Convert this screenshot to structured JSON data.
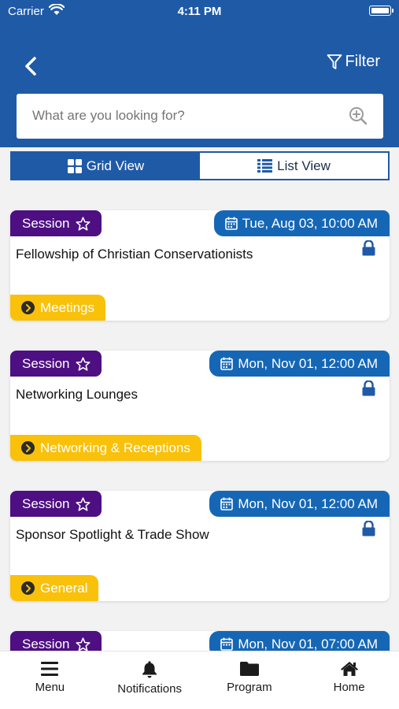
{
  "status_bar": {
    "carrier": "Carrier",
    "time": "4:11 PM"
  },
  "header": {
    "filter_label": "Filter"
  },
  "search": {
    "placeholder": "What are you looking for?"
  },
  "view_toggle": {
    "grid_label": "Grid View",
    "list_label": "List View",
    "active": "grid"
  },
  "colors": {
    "header_bg": "#1f5aa6",
    "session_badge": "#4d0f82",
    "date_badge": "#1567b6",
    "category_badge": "#f9c10a",
    "lock": "#1f5aa6"
  },
  "events": [
    {
      "type": "Session",
      "date": "Tue, Aug 03, 10:00 AM",
      "title": "Fellowship of Christian Conservationists",
      "category": "Meetings",
      "locked": true
    },
    {
      "type": "Session",
      "date": "Mon, Nov 01, 12:00 AM",
      "title": "Networking Lounges",
      "category": "Networking & Receptions",
      "locked": true
    },
    {
      "type": "Session",
      "date": "Mon, Nov 01, 12:00 AM",
      "title": "Sponsor Spotlight & Trade Show",
      "category": "General",
      "locked": true
    },
    {
      "type": "Session",
      "date": "Mon, Nov 01, 07:00 AM",
      "title": "",
      "category": "",
      "locked": false
    }
  ],
  "tab_bar": {
    "items": [
      {
        "label": "Menu",
        "icon": "menu-icon"
      },
      {
        "label": "Notifications",
        "icon": "bell-icon"
      },
      {
        "label": "Program",
        "icon": "folder-icon"
      },
      {
        "label": "Home",
        "icon": "home-icon"
      }
    ]
  }
}
